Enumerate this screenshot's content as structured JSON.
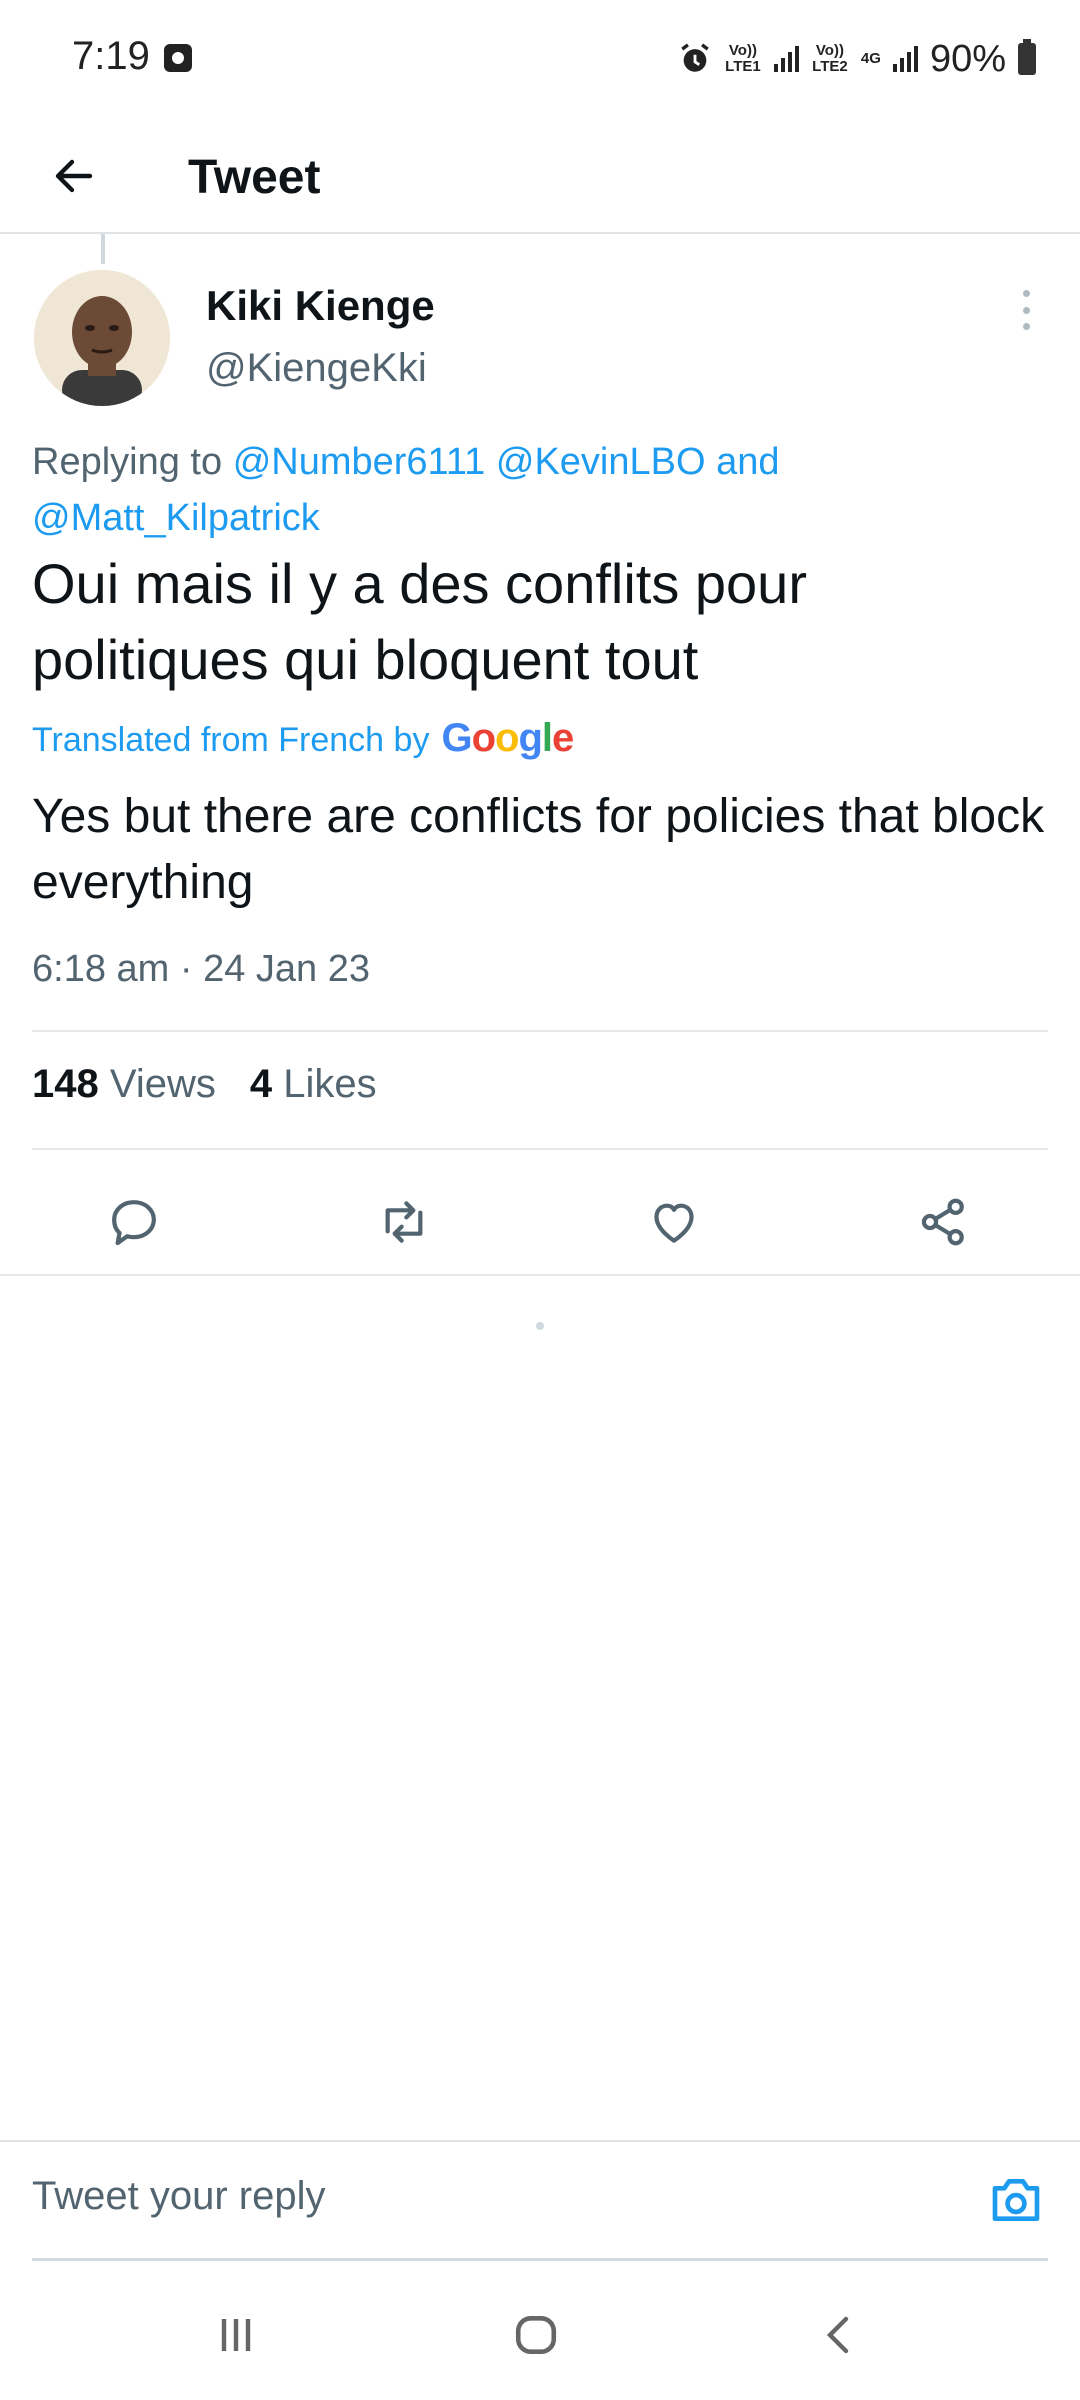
{
  "status_bar": {
    "time": "7:19",
    "lte1_label": "Vo)) LTE1",
    "lte2_label": "Vo)) LTE2",
    "network": "4G",
    "battery": "90%"
  },
  "header": {
    "title": "Tweet"
  },
  "tweet": {
    "author_name": "Kiki Kienge",
    "author_handle": "@KiengeKki",
    "replying_prefix": "Replying to",
    "mentions": [
      "@Number6111",
      "@KevinLBO",
      "@Matt_Kilpatrick"
    ],
    "replying_and": "and",
    "text": "Oui mais il y a des conflits pour politiques qui bloquent tout",
    "translated_label": "Translated from French by",
    "translation_provider": "Google",
    "translation": "Yes but there are conflicts for policies that block everything",
    "timestamp": "6:18 am · 24 Jan 23",
    "views_count": "148",
    "views_label": "Views",
    "likes_count": "4",
    "likes_label": "Likes"
  },
  "reply": {
    "placeholder": "Tweet your reply"
  },
  "colors": {
    "accent": "#1d9bf0",
    "text_primary": "#0f1419",
    "text_secondary": "#536471"
  },
  "icons": {
    "back": "arrow-left-icon",
    "more": "more-vertical-icon",
    "reply": "comment-icon",
    "retweet": "retweet-icon",
    "like": "heart-icon",
    "share": "share-icon",
    "camera": "camera-icon"
  }
}
